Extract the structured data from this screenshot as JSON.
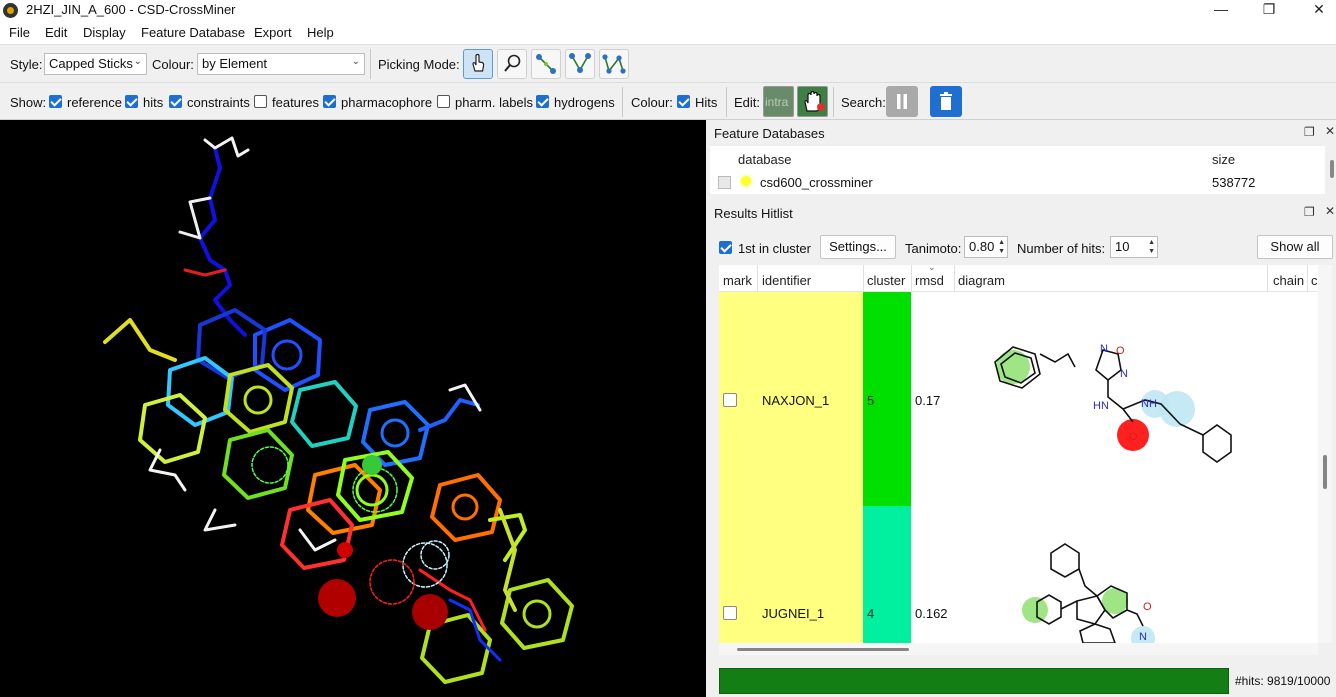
{
  "window": {
    "title": "2HZI_JIN_A_600 - CSD-CrossMiner",
    "minimize": "—",
    "maximize": "❐",
    "close": "✕"
  },
  "menu": [
    "File",
    "Edit",
    "Display",
    "Feature Database",
    "Export",
    "Help"
  ],
  "toolbar1": {
    "style_label": "Style:",
    "style_value": "Capped Sticks",
    "colour_label": "Colour:",
    "colour_value": "by Element",
    "picking_label": "Picking Mode:"
  },
  "toolbar2": {
    "show_label": "Show:",
    "checks": [
      {
        "label": "reference",
        "checked": true
      },
      {
        "label": "hits",
        "checked": true
      },
      {
        "label": "constraints",
        "checked": true
      },
      {
        "label": "features",
        "checked": false
      },
      {
        "label": "pharmacophore",
        "checked": true
      },
      {
        "label": "pharm. labels",
        "checked": false
      },
      {
        "label": "hydrogens",
        "checked": true
      }
    ],
    "colour_label": "Colour:",
    "colour_hits_label": "Hits",
    "edit_label": "Edit:",
    "intra_label": "intra",
    "search_label": "Search:"
  },
  "feature_db": {
    "title": "Feature Databases",
    "col_database": "database",
    "col_size": "size",
    "row": {
      "name": "csd600_crossminer",
      "size": "538772"
    }
  },
  "hitlist": {
    "title": "Results Hitlist",
    "first_in_cluster_label": "1st in cluster",
    "settings_button": "Settings...",
    "tanimoto_label": "Tanimoto:",
    "tanimoto_value": "0.80",
    "num_hits_label": "Number of hits:",
    "num_hits_value": "10",
    "show_all_button": "Show all",
    "columns": [
      "mark",
      "identifier",
      "cluster",
      "rmsd",
      "diagram",
      "chain",
      "c"
    ],
    "rows": [
      {
        "identifier": "NAXJON_1",
        "cluster": "5",
        "rmsd": "0.17",
        "diagram_labels": [
          "N",
          "O",
          "N",
          "HN",
          "NH",
          "O"
        ]
      },
      {
        "identifier": "JUGNEI_1",
        "cluster": "4",
        "rmsd": "0.162",
        "diagram_labels": [
          "O",
          "N"
        ]
      }
    ],
    "hits_status": "#hits: 9819/10000",
    "progress_fraction": 0.98
  },
  "colors": {
    "accent": "#1f6fd0",
    "mark_col": "#ffff80",
    "cluster5": "#00e000",
    "cluster4": "#00f0a0",
    "progress": "#137e13"
  }
}
